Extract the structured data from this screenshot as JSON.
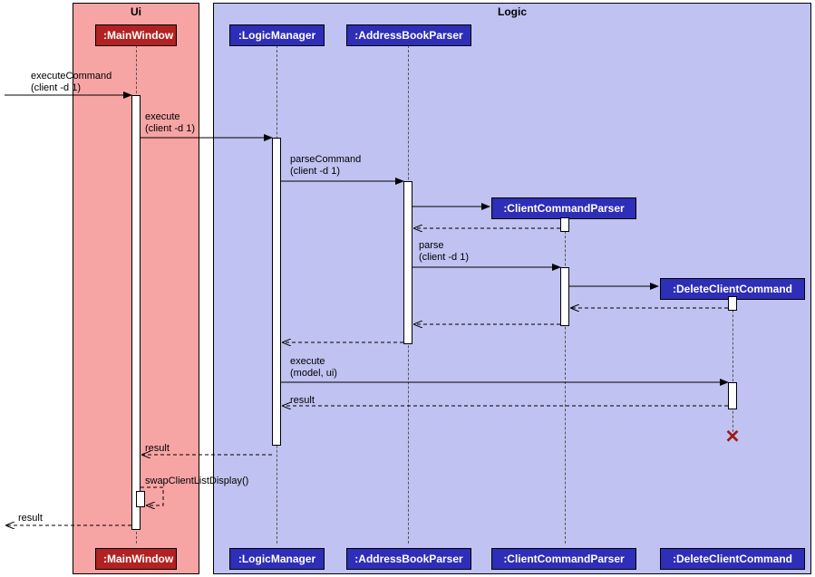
{
  "regions": {
    "ui": {
      "title": "Ui"
    },
    "logic": {
      "title": "Logic"
    }
  },
  "participants": {
    "mainwindow_top": ":MainWindow",
    "logicmanager_top": ":LogicManager",
    "abparser_top": ":AddressBookParser",
    "ccparser": ":ClientCommandParser",
    "dcc": ":DeleteClientCommand",
    "mainwindow_bot": ":MainWindow",
    "logicmanager_bot": ":LogicManager",
    "abparser_bot": ":AddressBookParser",
    "ccparser_bot": ":ClientCommandParser",
    "dcc_bot": ":DeleteClientCommand"
  },
  "messages": {
    "m1a": "executeCommand",
    "m1b": "(client -d 1)",
    "m2a": "execute",
    "m2b": "(client -d 1)",
    "m3a": "parseCommand",
    "m3b": "(client -d 1)",
    "m4a": "parse",
    "m4b": "(client -d 1)",
    "m5a": "execute",
    "m5b": "(model, ui)",
    "r1": "result",
    "r2": "result",
    "r3": "result",
    "self": "swapClientListDisplay()"
  },
  "chart_data": {
    "type": "sequence-diagram",
    "regions": [
      {
        "name": "Ui",
        "color": "#f7a4a4",
        "participants": [
          "MainWindow"
        ]
      },
      {
        "name": "Logic",
        "color": "#c0c2f1",
        "participants": [
          "LogicManager",
          "AddressBookParser",
          "ClientCommandParser",
          "DeleteClientCommand"
        ]
      }
    ],
    "participants": [
      {
        "id": "MainWindow",
        "label": ":MainWindow",
        "box_color": "#b22222"
      },
      {
        "id": "LogicManager",
        "label": ":LogicManager",
        "box_color": "#2e2eb8"
      },
      {
        "id": "AddressBookParser",
        "label": ":AddressBookParser",
        "box_color": "#2e2eb8"
      },
      {
        "id": "ClientCommandParser",
        "label": ":ClientCommandParser",
        "box_color": "#2e2eb8",
        "created_by": "AddressBookParser"
      },
      {
        "id": "DeleteClientCommand",
        "label": ":DeleteClientCommand",
        "box_color": "#2e2eb8",
        "created_by": "ClientCommandParser",
        "destroyed": true
      }
    ],
    "messages": [
      {
        "from": "external",
        "to": "MainWindow",
        "label": "executeCommand(client -d 1)",
        "kind": "sync"
      },
      {
        "from": "MainWindow",
        "to": "LogicManager",
        "label": "execute(client -d 1)",
        "kind": "sync"
      },
      {
        "from": "LogicManager",
        "to": "AddressBookParser",
        "label": "parseCommand(client -d 1)",
        "kind": "sync"
      },
      {
        "from": "AddressBookParser",
        "to": "ClientCommandParser",
        "label": "",
        "kind": "create"
      },
      {
        "from": "ClientCommandParser",
        "to": "AddressBookParser",
        "label": "",
        "kind": "return"
      },
      {
        "from": "AddressBookParser",
        "to": "ClientCommandParser",
        "label": "parse(client -d 1)",
        "kind": "sync"
      },
      {
        "from": "ClientCommandParser",
        "to": "DeleteClientCommand",
        "label": "",
        "kind": "create"
      },
      {
        "from": "DeleteClientCommand",
        "to": "ClientCommandParser",
        "label": "",
        "kind": "return"
      },
      {
        "from": "ClientCommandParser",
        "to": "AddressBookParser",
        "label": "",
        "kind": "return"
      },
      {
        "from": "AddressBookParser",
        "to": "LogicManager",
        "label": "",
        "kind": "return"
      },
      {
        "from": "LogicManager",
        "to": "DeleteClientCommand",
        "label": "execute(model, ui)",
        "kind": "sync"
      },
      {
        "from": "DeleteClientCommand",
        "to": "LogicManager",
        "label": "result",
        "kind": "return"
      },
      {
        "from": "DeleteClientCommand",
        "to": "DeleteClientCommand",
        "label": "",
        "kind": "destroy"
      },
      {
        "from": "LogicManager",
        "to": "MainWindow",
        "label": "result",
        "kind": "return"
      },
      {
        "from": "MainWindow",
        "to": "MainWindow",
        "label": "swapClientListDisplay()",
        "kind": "self"
      },
      {
        "from": "MainWindow",
        "to": "external",
        "label": "result",
        "kind": "return"
      }
    ]
  }
}
